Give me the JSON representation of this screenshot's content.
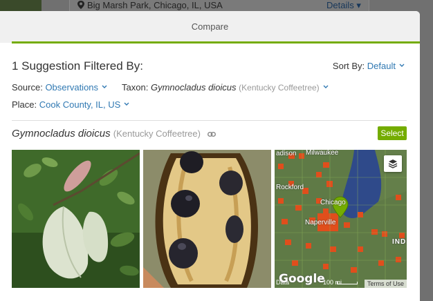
{
  "background": {
    "place": "Big Marsh Park, Chicago, IL, USA",
    "details_label": "Details"
  },
  "modal": {
    "title": "Compare"
  },
  "summary": "1 Suggestion Filtered By:",
  "sort": {
    "label": "Sort By:",
    "value": "Default"
  },
  "filters": {
    "source_label": "Source:",
    "source_value": "Observations",
    "taxon_label": "Taxon:",
    "taxon_scientific": "Gymnocladus dioicus",
    "taxon_common": "(Kentucky Coffeetree)",
    "place_label": "Place:",
    "place_value": "Cook County, IL, US"
  },
  "result": {
    "scientific_name": "Gymnocladus dioicus",
    "common_name": "(Kentucky Coffeetree)",
    "select_label": "Select"
  },
  "map": {
    "labels": {
      "milwaukee": "Milwaukee",
      "rockford": "Rockford",
      "chicago": "Chicago",
      "naperville": "Naperville",
      "indiana": "INDIANA",
      "adison": "adison"
    },
    "google": "Google",
    "data": "Data",
    "scale": "100 mi",
    "terms": "Terms of Use"
  },
  "colors": {
    "accent_green": "#74ac00",
    "link_blue": "#2f78b2"
  }
}
